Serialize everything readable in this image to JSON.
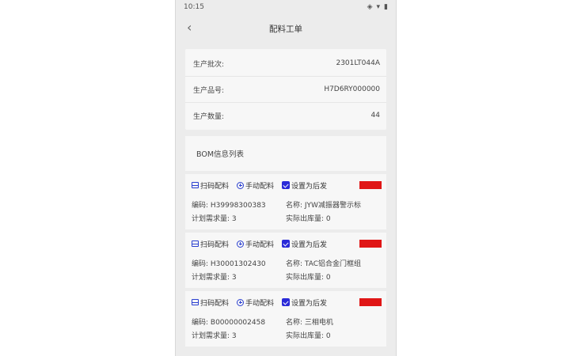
{
  "status": {
    "time": "10:15"
  },
  "nav": {
    "title": "配料工单"
  },
  "info": [
    {
      "label": "生产批次:",
      "value": "2301LT044A"
    },
    {
      "label": "生产品号:",
      "value": "H7D6RY000000"
    },
    {
      "label": "生产数量:",
      "value": "44"
    }
  ],
  "bom": {
    "header": "BOM信息列表",
    "actions": {
      "scan": "扫码配料",
      "manual": "手动配料",
      "set_later": "设置为后发"
    },
    "items": [
      {
        "code": "编码: H39998300383",
        "name": "名称: JYW减振器警示标",
        "plan": "计划需求量: 3",
        "actual": "实际出库量: 0"
      },
      {
        "code": "编码: H30001302430",
        "name": "名称: TAC铝合金门框组",
        "plan": "计划需求量: 3",
        "actual": "实际出库量: 0"
      },
      {
        "code": "编码: B00000002458",
        "name": "名称: 三相电机",
        "plan": "计划需求量: 3",
        "actual": "实际出库量: 0"
      }
    ]
  },
  "colors": {
    "accent": "#2a3fd0",
    "tag_red": "#e01616"
  }
}
